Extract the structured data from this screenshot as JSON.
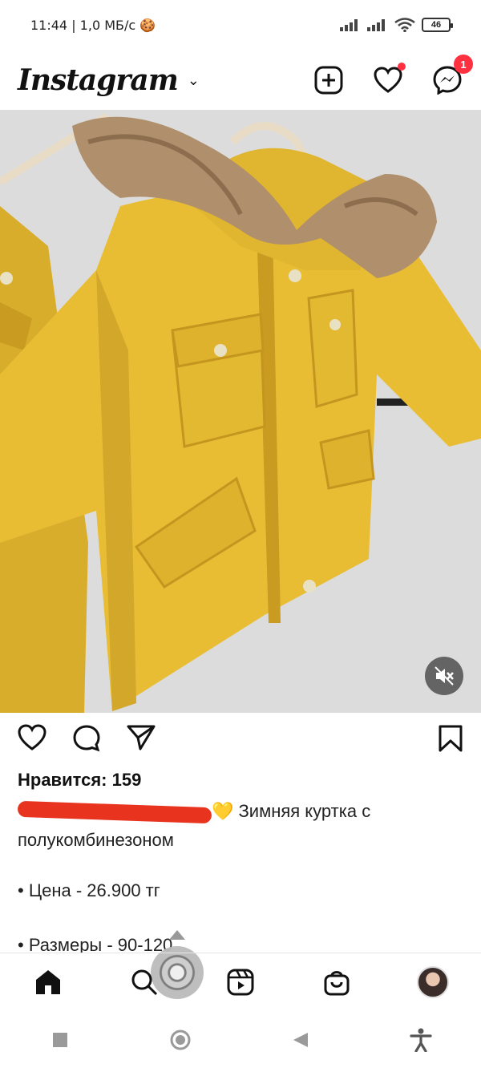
{
  "status_bar": {
    "time": "11:44",
    "net_speed": "| 1,0 МБ/с",
    "battery": "46"
  },
  "header": {
    "app_title": "Instagram",
    "message_badge_count": "1"
  },
  "post": {
    "likes": "Нравится: 159",
    "caption_suffix": "💛 Зимняя куртка с полукомбинезоном",
    "price": "• Цена - 26.900 тг",
    "sizes": "• Размеры - 90-120"
  },
  "colors": {
    "accent_red": "#ff3040",
    "jacket_yellow": "#e8bd34",
    "redaction_red": "#e8341f"
  }
}
